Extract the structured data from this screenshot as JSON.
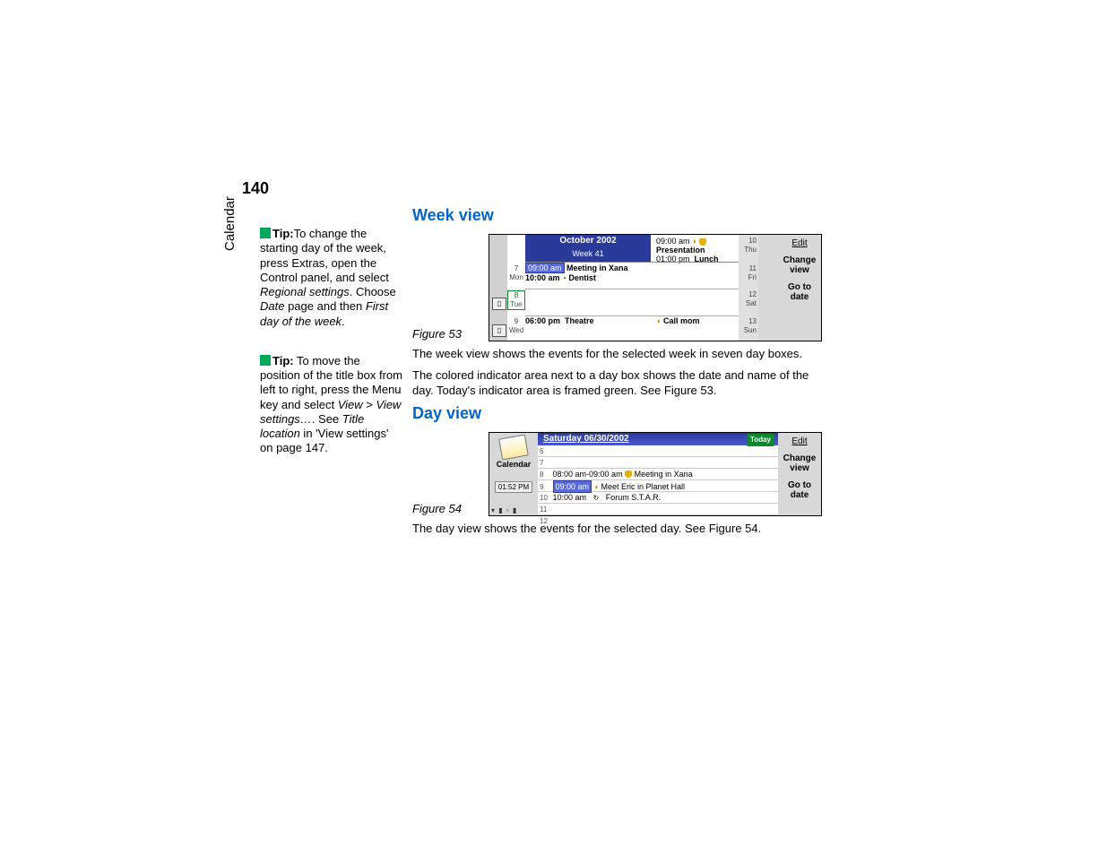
{
  "page_number": "140",
  "side_label": "Calendar",
  "tips": [
    {
      "label": "Tip:",
      "text_a": "To change the starting day of the week, press Extras, open the Control panel, and select ",
      "em_a": "Regional settings",
      "text_b": ". Choose ",
      "em_b": "Date",
      "text_c": " page and then ",
      "em_c": "First day of the week",
      "text_d": "."
    },
    {
      "label": "Tip:",
      "text_a": " To move the position of the title box from left to right, press the Menu key and select ",
      "em_a": "View",
      "text_b": " > ",
      "em_b": "View settings…",
      "text_c": ". See ",
      "em_c": "Title location",
      "text_d": " in 'View settings' on page 147."
    }
  ],
  "headings": {
    "week": "Week view",
    "day": "Day view"
  },
  "captions": {
    "fig53": "Figure 53",
    "fig54": "Figure 54"
  },
  "paragraphs": {
    "p1": "The week view shows the events for the selected week in seven day boxes.",
    "p2": "The colored indicator area next to a day box shows the date and name of the day. Today's indicator area is framed green. See Figure 53.",
    "p3": "The day view shows the events for the selected day. See Figure 54."
  },
  "week_fig": {
    "title": "October 2002",
    "subtitle": "Week 41",
    "left_days": [
      {
        "num": "7",
        "name": "Mon"
      },
      {
        "num": "8",
        "name": "Tue"
      },
      {
        "num": "9",
        "name": "Wed"
      }
    ],
    "header_events": [
      {
        "time": "09:00 am",
        "label": "Presentation",
        "bell": true
      },
      {
        "time": "01:00 pm",
        "label": "Lunch",
        "bell": false
      }
    ],
    "mon_events": [
      {
        "time": "09:00 am",
        "label": "Meeting in Xana",
        "sel": true
      },
      {
        "time": "10:00 am",
        "label": "Dentist",
        "icon": "watch"
      }
    ],
    "wed_events": [
      {
        "time": "06:00 pm",
        "label": "Theatre"
      }
    ],
    "wed_right_event": "Call mom",
    "right_days": [
      {
        "num": "10",
        "name": "Thu"
      },
      {
        "num": "11",
        "name": "Fri"
      },
      {
        "num": "12",
        "name": "Sat"
      },
      {
        "num": "13",
        "name": "Sun"
      }
    ],
    "buttons": {
      "edit": "Edit",
      "change": "Change view",
      "goto": "Go to date"
    }
  },
  "day_fig": {
    "left_label": "Calendar",
    "clock": "01:52 PM",
    "header": "Saturday  06/30/2002",
    "today_btn": "Today",
    "rows": [
      {
        "h": "6",
        "text": ""
      },
      {
        "h": "7",
        "text": ""
      },
      {
        "h": "8",
        "text": "08:00 am-09:00 am",
        "after": "Meeting in Xana",
        "bell": true
      },
      {
        "h": "9",
        "text": "",
        "timesel": "09:00 am",
        "after": "Meet Eric in Planet Hall",
        "mark": true
      },
      {
        "h": "10",
        "text": "10:00 am",
        "after": "Forum S.T.A.R.",
        "icon": true
      },
      {
        "h": "11",
        "text": ""
      },
      {
        "h": "12",
        "text": ""
      }
    ],
    "buttons": {
      "edit": "Edit",
      "change": "Change view",
      "goto": "Go to date"
    }
  }
}
